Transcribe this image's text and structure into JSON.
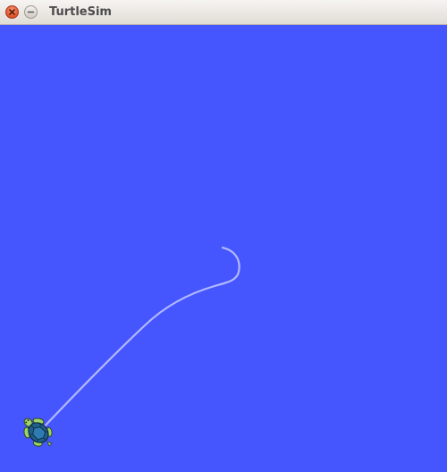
{
  "window": {
    "title": "TurtleSim",
    "controls": [
      "close-icon",
      "minimize-icon"
    ]
  },
  "canvas": {
    "background_color": "#4556ff",
    "pen_color": "#b3b8ff",
    "turtle": {
      "shell_color": "#1f5f8b",
      "body_color": "#9ed36a"
    }
  }
}
